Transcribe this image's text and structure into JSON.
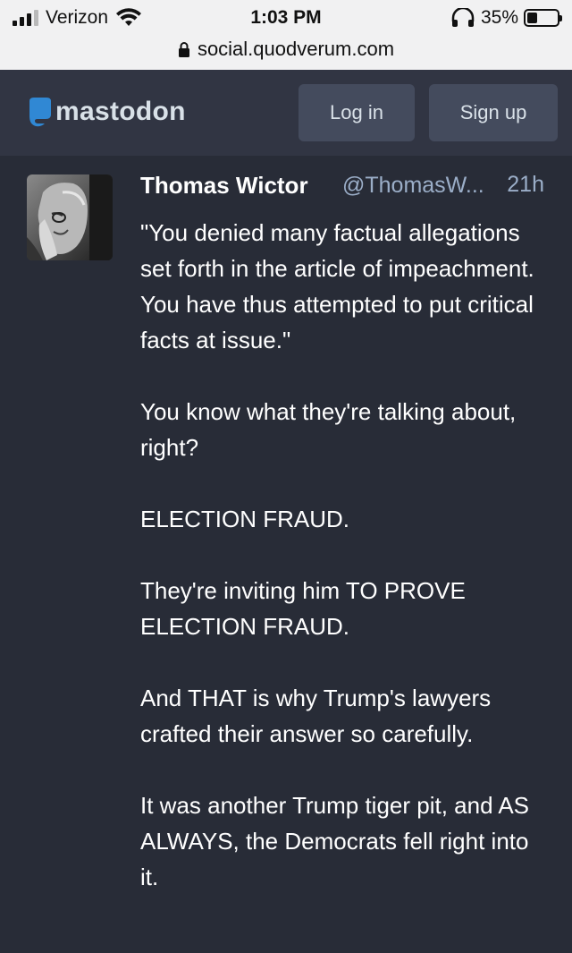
{
  "ios": {
    "carrier": "Verizon",
    "time": "1:03 PM",
    "battery": "35%",
    "battery_level": 0.35,
    "url": "social.quodverum.com"
  },
  "header": {
    "logo_text": "mastodon",
    "login_label": "Log in",
    "signup_label": "Sign up"
  },
  "status": {
    "display_name": "Thomas Wictor",
    "acct": "@ThomasW...",
    "time": "21h",
    "paragraphs": [
      "\"You denied many factual allegations set forth in the article of impeachment. You have thus attempted to put critical facts at issue.\"",
      "You know what they're talking about, right?",
      "ELECTION FRAUD.",
      "They're inviting him TO PROVE ELECTION FRAUD.",
      "And THAT is why Trump's lawyers crafted their answer so carefully.",
      "It was another Trump tiger pit, and AS ALWAYS, the Democrats fell right into it."
    ]
  },
  "colors": {
    "background": "#282c37",
    "header": "#313543",
    "button": "#444b5d",
    "secondary_text": "#9baec8"
  }
}
